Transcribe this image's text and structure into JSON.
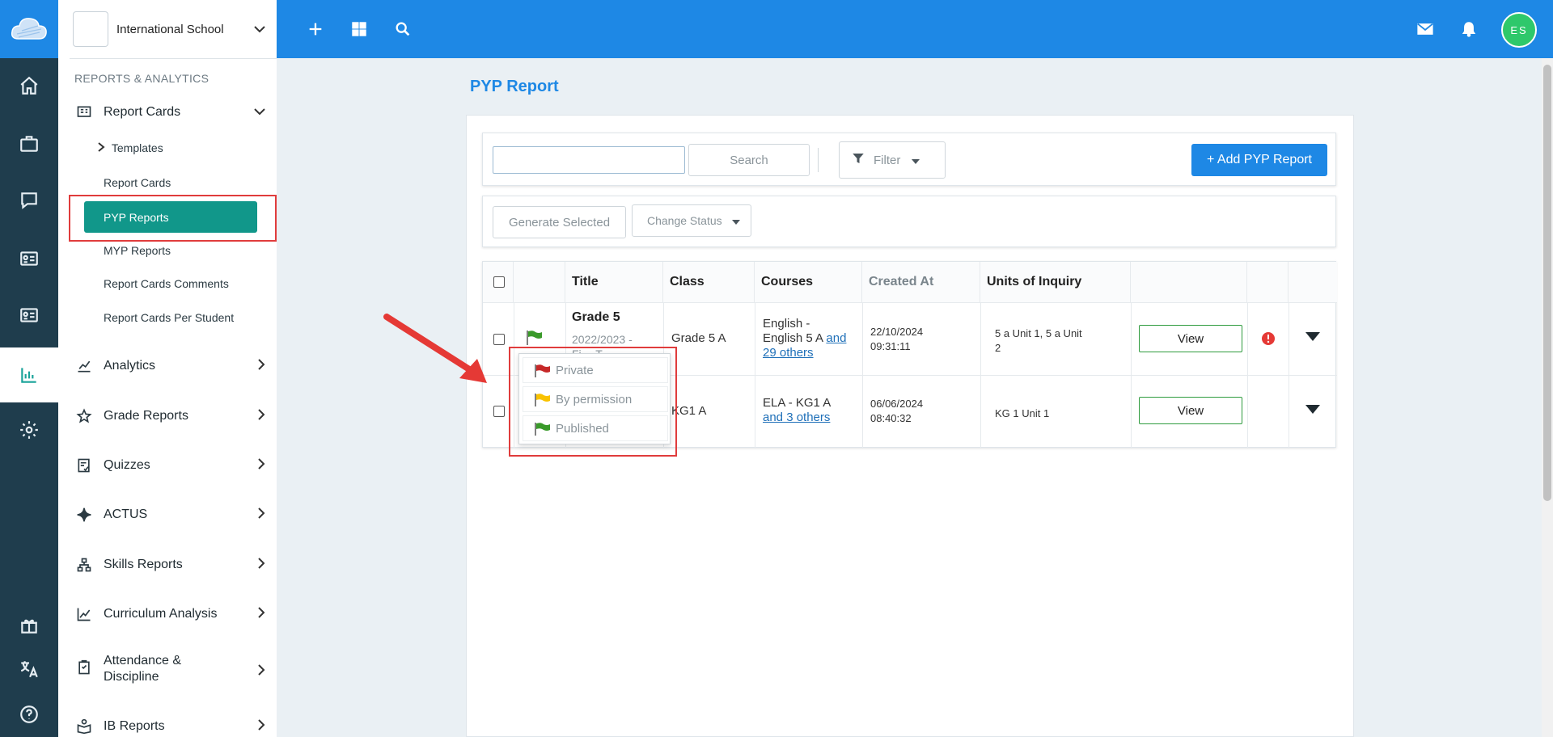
{
  "topbar": {
    "avatar_initials": "ES",
    "accent": "#1e88e5"
  },
  "sidebar": {
    "school_name": "International School",
    "section_title": "REPORTS & ANALYTICS",
    "report_cards": "Report Cards",
    "templates": "Templates",
    "report_cards_sub": "Report Cards",
    "pyp_reports": "PYP Reports",
    "myp_reports": "MYP Reports",
    "report_cards_comments": "Report Cards Comments",
    "report_cards_per_student": "Report Cards Per Student",
    "analytics": "Analytics",
    "grade_reports": "Grade Reports",
    "quizzes": "Quizzes",
    "actus": "ACTUS",
    "skills_reports": "Skills Reports",
    "curriculum_analysis": "Curriculum Analysis",
    "attendance_line1": "Attendance &",
    "attendance_line2": "Discipline",
    "ib_reports": "IB Reports"
  },
  "main": {
    "page_title": "PYP Report",
    "search_label": "Search",
    "filter_label": "Filter",
    "add_label": "+ Add PYP Report",
    "generate_label": "Generate Selected",
    "change_status_label": "Change Status",
    "columns": [
      "Title",
      "Class",
      "Courses",
      "Created At",
      "Units of Inquiry"
    ],
    "rows": [
      {
        "title": "Grade 5",
        "subtitle": "2022/2023 -",
        "subtitle2": "Fi… T…",
        "class": "Grade 5 A",
        "courses_line1": "English -",
        "courses_line2": "English 5 A",
        "courses_link1": "and",
        "courses_link2": "29 others",
        "created_date": "22/10/2024",
        "created_time": "09:31:11",
        "units_line1": "5 a Unit 1, 5 a Unit",
        "units_line2": "2",
        "view": "View"
      },
      {
        "class": "KG1 A",
        "courses_line1": "ELA - KG1 A",
        "courses_link": "and 3 others",
        "created_date": "06/06/2024",
        "created_time": "08:40:32",
        "units": "KG 1 Unit 1",
        "view": "View"
      }
    ],
    "status_menu": [
      {
        "label": "Private",
        "color": "#c62828"
      },
      {
        "label": "By permission",
        "color": "#f9c200"
      },
      {
        "label": "Published",
        "color": "#3a9a2a"
      }
    ]
  }
}
